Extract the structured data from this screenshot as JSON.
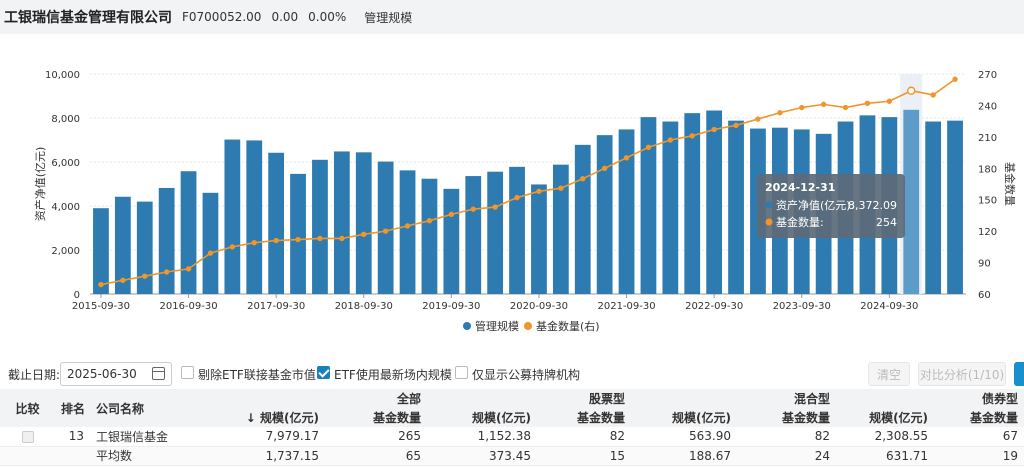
{
  "header": {
    "company": "工银瑞信基金管理有限公司",
    "code": "F0700052.00",
    "change": "0.00",
    "change_pct": "0.00%",
    "tab": "管理规模"
  },
  "colors": {
    "bar": "#2d7bb0",
    "bar_highlight": "#5d9cc8",
    "line": "#f0962a",
    "tooltip_bg": "#5c6b78"
  },
  "chart_data": {
    "type": "bar",
    "x_tick_labels": [
      "2015-09-30",
      "2016-09-30",
      "2017-09-30",
      "2018-09-30",
      "2019-09-30",
      "2020-09-30",
      "2021-09-30",
      "2022-09-30",
      "2023-09-30",
      "2024-09-30"
    ],
    "ylabel": "资产净值(亿元)",
    "y2label": "基金数量",
    "ylim": [
      0,
      10000
    ],
    "y_ticks": [
      "0",
      "2,000",
      "4,000",
      "6,000",
      "8,000",
      "10,000"
    ],
    "y2lim": [
      60,
      270
    ],
    "y2_ticks": [
      "60",
      "90",
      "120",
      "150",
      "180",
      "210",
      "240",
      "270"
    ],
    "legend_position": "bottom-center",
    "grid": true,
    "series": [
      {
        "name": "管理规模",
        "type": "bar",
        "axis": "left",
        "values": [
          3900,
          4420,
          4200,
          4820,
          5580,
          4600,
          7020,
          6980,
          6420,
          5460,
          6100,
          6480,
          6440,
          6020,
          5620,
          5240,
          4780,
          5360,
          5560,
          5780,
          4980,
          5880,
          6780,
          7220,
          7480,
          8040,
          7840,
          8220,
          8340,
          7880,
          7520,
          7560,
          7480,
          7280,
          7840,
          8120,
          8040,
          8372.09,
          7840,
          7880
        ]
      },
      {
        "name": "基金数量(右)",
        "type": "line",
        "axis": "right",
        "values": [
          69,
          73,
          77,
          81,
          84,
          99,
          105,
          109,
          111,
          112,
          113,
          113,
          117,
          120,
          125,
          130,
          136,
          141,
          143,
          152,
          158,
          161,
          170,
          180,
          190,
          200,
          207,
          211,
          217,
          221,
          227,
          233,
          238,
          241,
          238,
          242,
          244,
          254,
          250,
          265
        ]
      }
    ],
    "tooltip": {
      "date": "2024-12-31",
      "rows": [
        {
          "label": "资产净值(亿元):",
          "value": "8,372.09"
        },
        {
          "label": "基金数量:",
          "value": "254"
        }
      ]
    }
  },
  "filters": {
    "date_label": "截止日期:",
    "date_value": "2025-06-30",
    "options": [
      {
        "label": "剔除ETF联接基金市值",
        "checked": false
      },
      {
        "label": "ETF使用最新场内规模",
        "checked": true
      },
      {
        "label": "仅显示公募持牌机构",
        "checked": false
      }
    ],
    "clear_label": "清空",
    "compare_label": "对比分析(1/10)"
  },
  "table": {
    "group_headers": [
      "全部",
      "股票型",
      "混合型",
      "债券型"
    ],
    "columns": [
      "比较",
      "排名",
      "公司名称",
      "↓ 规模(亿元)",
      "基金数量",
      "规模(亿元)",
      "基金数量",
      "规模(亿元)",
      "基金数量",
      "规模(亿元)",
      "基金数量"
    ],
    "rows": [
      {
        "rank": "13",
        "name": "工银瑞信基金",
        "cells": [
          "7,979.17",
          "265",
          "1,152.38",
          "82",
          "563.90",
          "82",
          "2,308.55",
          "67"
        ]
      },
      {
        "rank": "",
        "name": "平均数",
        "cells": [
          "1,737.15",
          "65",
          "373.45",
          "15",
          "188.67",
          "24",
          "631.71",
          "19"
        ]
      }
    ]
  }
}
